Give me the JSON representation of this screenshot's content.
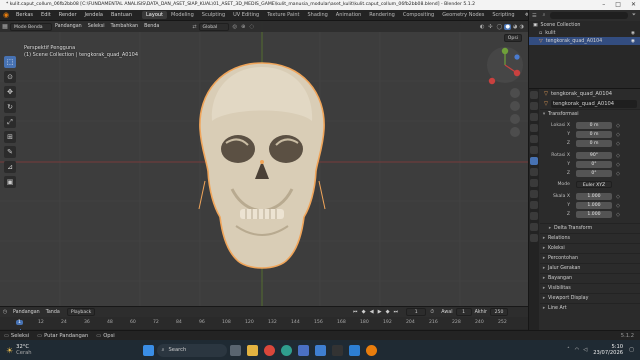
{
  "window": {
    "title": "* kulit.caput_collum_06fb2bb08 [C:\\FUNDAMENTAL ANALISIS\\DATA_DAN_ASET_SIAP_KUAL\\01_ASET_3D_MEDIS_GAME\\kulit_manusia_modular\\aset_kulit\\kulit.caput_collum_06fb2bb08.blend] - Blender 5.1.2"
  },
  "menubar": {
    "items": [
      "Berkas",
      "Edit",
      "Render",
      "Jendela",
      "Bantuan"
    ],
    "workspaces": [
      "Layout",
      "Modeling",
      "Sculpting",
      "UV Editing",
      "Texture Paint",
      "Shading",
      "Animation",
      "Rendering",
      "Compositing",
      "Geometry Nodes",
      "Scripting"
    ],
    "active_workspace": "Layout",
    "scene": "Scene",
    "view_layer": "ViewLayer"
  },
  "viewport_header": {
    "mode": "Mode Benda",
    "menus": [
      "Pandangan",
      "Seleksi",
      "Tambahkan",
      "Benda"
    ],
    "orientation": "Global",
    "options": "Opsi"
  },
  "viewport": {
    "view_name": "Perspektif Pengguna",
    "collection_info": "(1) Scene Collection | tengkorak_quad_A0104"
  },
  "outliner": {
    "items": [
      {
        "label": "Scene Collection",
        "indent": 0
      },
      {
        "label": "kulit",
        "indent": 1
      },
      {
        "label": "tengkorak_quad_A0104",
        "indent": 1,
        "selected": true
      }
    ]
  },
  "properties": {
    "object_name": "tengkorak_quad_A0104",
    "data_name": "tengkorak_quad_A0104",
    "transform_title": "Transformasi",
    "location_label": "Lokasi X",
    "location": [
      "0 m",
      "0 m",
      "0 m"
    ],
    "rotation_label": "Rotasi X",
    "rotation": [
      "90°",
      "0°",
      "0°"
    ],
    "mode_label": "Mode",
    "mode_value": "Euler XYZ",
    "scale_label": "Skala X",
    "scale": [
      "1.000",
      "1.000",
      "1.000"
    ],
    "axis_y": "Y",
    "axis_z": "Z",
    "sections": [
      "Delta Transform",
      "Relations",
      "Koleksi",
      "Percontohan",
      "Jalur Gerakan",
      "Bayangan",
      "Visibilitas",
      "Viewport Display",
      "Line Art"
    ]
  },
  "timeline": {
    "menus": [
      "Pandangan",
      "Tanda"
    ],
    "playback": "Playback",
    "current_frame": "1",
    "start_label": "Awal",
    "start": "1",
    "end_label": "Akhir",
    "end": "250",
    "ticks": [
      "1",
      "12",
      "24",
      "36",
      "48",
      "60",
      "72",
      "84",
      "96",
      "108",
      "120",
      "132",
      "144",
      "156",
      "168",
      "180",
      "192",
      "204",
      "216",
      "228",
      "240",
      "252"
    ]
  },
  "statusbar": {
    "left": [
      "Seleksi",
      "Putar Pandangan",
      "Opsi"
    ],
    "version": "5.1.2"
  },
  "taskbar": {
    "weather_temp": "32°C",
    "weather_desc": "Cerah",
    "search": "Search",
    "time": "5:10",
    "date": "23/07/2026"
  },
  "colors": {
    "accent": "#4772b3",
    "selection_outline": "#f0a55a",
    "viewport_bg": "#3d3d3d"
  }
}
